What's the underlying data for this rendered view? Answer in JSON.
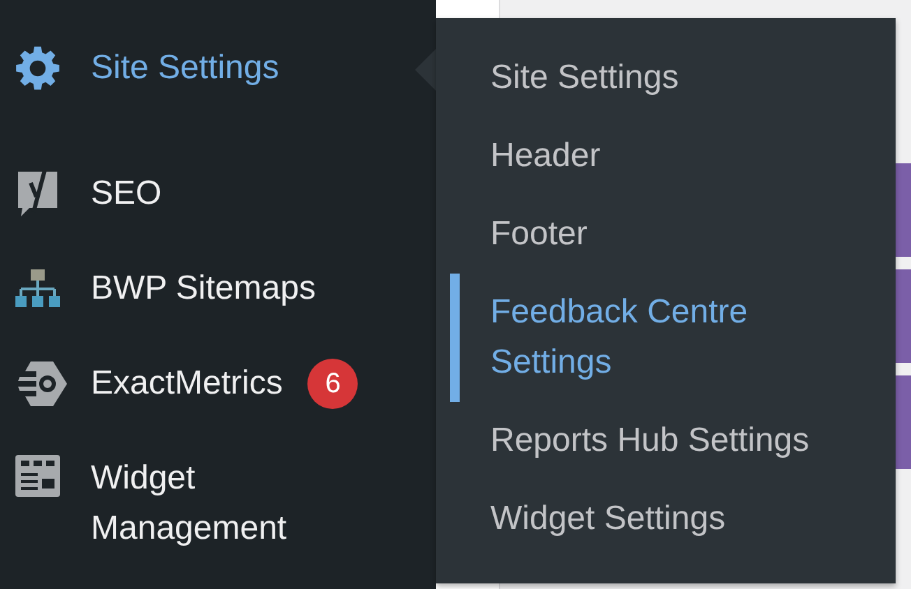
{
  "sidebar": {
    "items": [
      {
        "label": "Site Settings",
        "selected": true
      },
      {
        "label": "SEO",
        "selected": false
      },
      {
        "label": "BWP Sitemaps",
        "selected": false
      },
      {
        "label": "ExactMetrics",
        "selected": false,
        "badge": "6"
      },
      {
        "label": "Widget Management",
        "selected": false
      }
    ]
  },
  "submenu": {
    "items": [
      {
        "label": "Site Settings",
        "selected": false
      },
      {
        "label": "Header",
        "selected": false
      },
      {
        "label": "Footer",
        "selected": false
      },
      {
        "label": "Feedback Centre Settings",
        "selected": true
      },
      {
        "label": "Reports Hub Settings",
        "selected": false
      },
      {
        "label": "Widget Settings",
        "selected": false
      }
    ]
  },
  "page_behind": {
    "buttons": [
      {
        "kind": "button"
      },
      {
        "kind": "button"
      },
      {
        "kind": "button"
      }
    ]
  }
}
